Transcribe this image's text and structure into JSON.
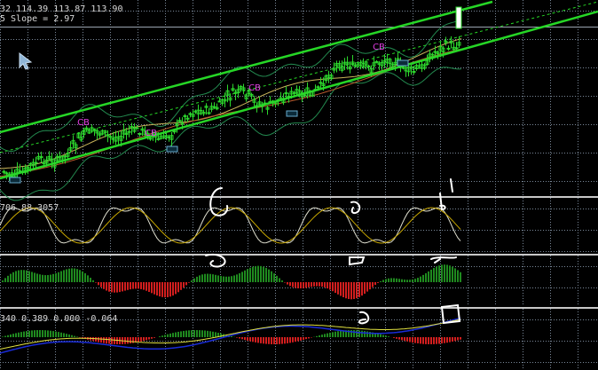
{
  "main": {
    "ohlc_line": "32 114.39 113.87 113.90",
    "slope_line": "5 Slope = 2.97",
    "label_text": "CB",
    "marker_text": "▭"
  },
  "stochastic": {
    "values_line": "706 88.3057"
  },
  "macd": {
    "values_line": "340 0.389 0.000 -0.064"
  },
  "colors": {
    "background": "#000000",
    "grid": "#7a8899",
    "channel": "#26d626",
    "candle": "#2cd62c",
    "label": "#e23ce2",
    "marker": "#66aacc",
    "bollinger": "#238a4f",
    "ma_fast": "#c8b45a",
    "ma_slow": "#b85a2c",
    "stoch_main": "#e0e0d0",
    "stoch_signal": "#c8a800",
    "hist_up": "#1f8a1f",
    "hist_down": "#d21e1e",
    "macd_main": "#1a2cd8",
    "macd_signal": "#e0e040",
    "annotation": "#ffffff"
  },
  "icons": [
    "cursor-arrow-icon",
    "drawing-annotation"
  ]
}
